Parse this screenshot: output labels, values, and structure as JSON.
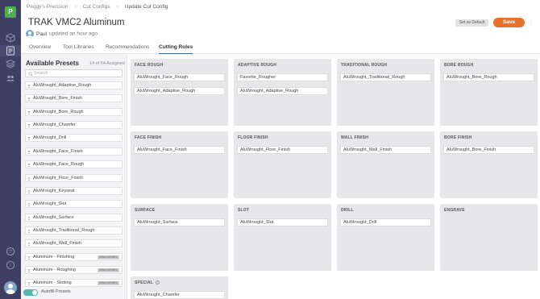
{
  "brand": {
    "logo_text": "P"
  },
  "rail": {
    "items": [
      {
        "icon": "cube-icon"
      },
      {
        "icon": "config-icon"
      },
      {
        "icon": "layers-icon"
      },
      {
        "icon": "team-icon"
      },
      {
        "icon": "help-icon"
      },
      {
        "icon": "info-icon"
      }
    ]
  },
  "breadcrumb": {
    "root": "Peggy's Precision",
    "section": "Cut Configs",
    "current": "Update Cut Config"
  },
  "header": {
    "title": "TRAK VMC2 Aluminum",
    "user": "Paul",
    "updated_text": "updated an hour ago",
    "set_default_label": "Set as Default",
    "save_label": "Save"
  },
  "tabs": [
    {
      "label": "Overview",
      "active": false
    },
    {
      "label": "Tool Libraries",
      "active": false
    },
    {
      "label": "Recommendations",
      "active": false
    },
    {
      "label": "Cutting Roles",
      "active": true
    }
  ],
  "sidebar": {
    "title": "Available Presets",
    "count": "14 of 54 Assigned",
    "search_placeholder": "Search",
    "presets": [
      {
        "label": "AluWrought_Adaptive_Rough",
        "badge": ""
      },
      {
        "label": "AluWrought_Bore_Finish",
        "badge": ""
      },
      {
        "label": "AluWrought_Bore_Rough",
        "badge": ""
      },
      {
        "label": "AluWrought_Chamfer",
        "badge": ""
      },
      {
        "label": "AluWrought_Drill",
        "badge": ""
      },
      {
        "label": "AluWrought_Face_Finish",
        "badge": ""
      },
      {
        "label": "AluWrought_Face_Rough",
        "badge": ""
      },
      {
        "label": "AluWrought_Floor_Finish",
        "badge": ""
      },
      {
        "label": "AluWrought_Keyseat",
        "badge": ""
      },
      {
        "label": "AluWrought_Slot",
        "badge": ""
      },
      {
        "label": "AluWrought_Surface",
        "badge": ""
      },
      {
        "label": "AluWrought_Traditional_Rough",
        "badge": ""
      },
      {
        "label": "AluWrought_Wall_Finish",
        "badge": ""
      },
      {
        "label": "Aluminum - Finishing",
        "badge": "UNASSIGNED"
      },
      {
        "label": "Aluminum - Roughing",
        "badge": "UNASSIGNED"
      },
      {
        "label": "Aluminum - Slotting",
        "badge": "UNASSIGNED"
      }
    ],
    "autofill_label": "Autofill Presets",
    "autofill_on": true
  },
  "roles": [
    {
      "title": "FACE ROUGH",
      "presets": [
        "AluWrought_Face_Rough",
        "AluWrought_Adaptive_Rough"
      ]
    },
    {
      "title": "ADAPTIVE ROUGH",
      "presets": [
        "Favorite_Rougher",
        "AluWrought_Adaptive_Rough"
      ]
    },
    {
      "title": "TRADITIONAL ROUGH",
      "presets": [
        "AluWrought_Traditional_Rough"
      ]
    },
    {
      "title": "BORE ROUGH",
      "presets": [
        "AluWrought_Bore_Rough"
      ]
    },
    {
      "title": "FACE FINISH",
      "presets": [
        "AluWrought_Face_Finish"
      ]
    },
    {
      "title": "FLOOR FINISH",
      "presets": [
        "AluWrought_Floor_Finish"
      ]
    },
    {
      "title": "WALL FINISH",
      "presets": [
        "AluWrought_Wall_Finish"
      ]
    },
    {
      "title": "BORE FINISH",
      "presets": [
        "AluWrought_Bore_Finish"
      ]
    },
    {
      "title": "SURFACE",
      "presets": [
        "AluWrought_Surface"
      ]
    },
    {
      "title": "SLOT",
      "presets": [
        "AluWrought_Slot"
      ]
    },
    {
      "title": "DRILL",
      "presets": [
        "AluWrought_Drill"
      ]
    },
    {
      "title": "ENGRAVE",
      "presets": []
    },
    {
      "title": "SPECIAL",
      "presets": [
        "AluWrought_Chamfer"
      ],
      "info_icon": "info-icon"
    }
  ],
  "colors": {
    "rail": "#3e3f63",
    "accent": "#e8722c",
    "brand": "#4db04f",
    "toggle": "#56b7b0",
    "active_tab": "#3e5fa8"
  }
}
